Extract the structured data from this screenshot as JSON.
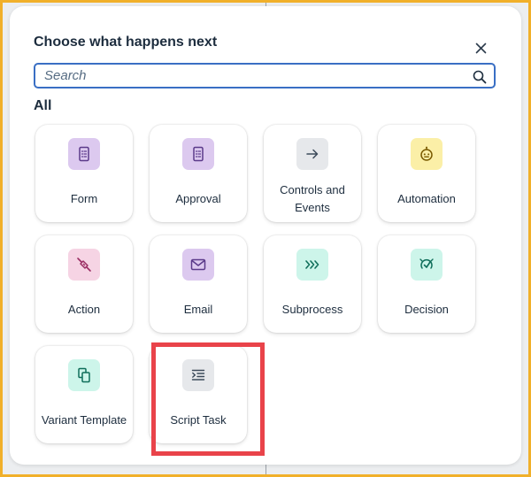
{
  "dialog": {
    "title": "Choose what happens next",
    "close_icon": "close-icon",
    "search": {
      "placeholder": "Search",
      "value": "",
      "icon": "search-icon"
    },
    "section_label": "All",
    "tiles": [
      {
        "id": "form",
        "label": "Form",
        "icon": "form-icon",
        "color": "#dcc9ef"
      },
      {
        "id": "approval",
        "label": "Approval",
        "icon": "approval-icon",
        "color": "#dcc9ef"
      },
      {
        "id": "controls-and-events",
        "label": "Controls and Events",
        "icon": "arrow-right-icon",
        "color": "#e6e8eb"
      },
      {
        "id": "automation",
        "label": "Automation",
        "icon": "robot-icon",
        "color": "#fbefa7"
      },
      {
        "id": "action",
        "label": "Action",
        "icon": "plug-icon",
        "color": "#f6d4e4"
      },
      {
        "id": "email",
        "label": "Email",
        "icon": "envelope-icon",
        "color": "#dcc9ef"
      },
      {
        "id": "subprocess",
        "label": "Subprocess",
        "icon": "chevrons-right-icon",
        "color": "#cdf5ea"
      },
      {
        "id": "decision",
        "label": "Decision",
        "icon": "decision-icon",
        "color": "#cdf5ea"
      },
      {
        "id": "variant-template",
        "label": "Variant Template",
        "icon": "copy-icon",
        "color": "#cdf5ea"
      },
      {
        "id": "script-task",
        "label": "Script Task",
        "icon": "indent-icon",
        "color": "#e6e8eb"
      }
    ]
  },
  "colors": {
    "frame": "#f1b02a",
    "accent": "#3a6fc4",
    "highlight": "#e9434a",
    "text": "#1d2d3e"
  }
}
